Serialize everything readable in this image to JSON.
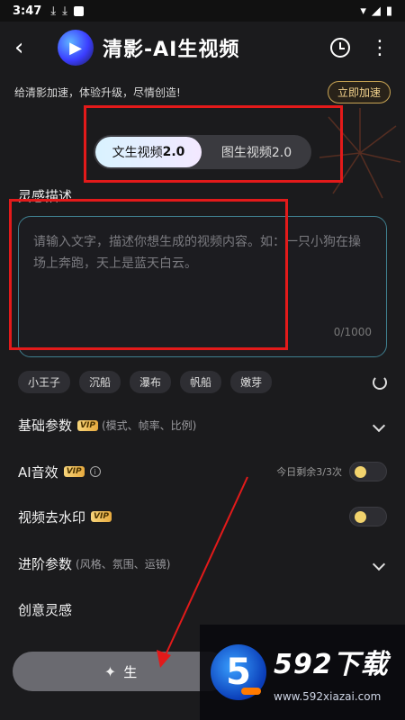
{
  "status": {
    "time": "3:47"
  },
  "header": {
    "back": "‹",
    "logo_letter": "▶",
    "title": "清影-AI生视频"
  },
  "promo": {
    "text": "给清影加速，体验升级，尽情创造!",
    "button": "立即加速"
  },
  "modes": {
    "active_label": "文生视频",
    "active_version": "2.0",
    "inactive_label": "图生视频2.0"
  },
  "prompt": {
    "label": "灵感描述",
    "placeholder": "请输入文字，描述你想生成的视频内容。如：一只小狗在操场上奔跑，天上是蓝天白云。",
    "counter": "0/1000"
  },
  "chips": [
    "小王子",
    "沉船",
    "瀑布",
    "帆船",
    "嫩芽"
  ],
  "settings": {
    "basic": {
      "title": "基础参数",
      "vip": "VIP",
      "sub": "(模式、帧率、比例)"
    },
    "audio": {
      "title": "AI音效",
      "vip": "VIP",
      "quota": "今日剩余3/3次"
    },
    "watermark": {
      "title": "视频去水印",
      "vip": "VIP"
    },
    "advanced": {
      "title": "进阶参数",
      "sub": "(风格、氛围、运镜)"
    }
  },
  "inspire": {
    "title": "创意灵感"
  },
  "generate": {
    "label": "生"
  },
  "site_watermark": {
    "title": "592下载",
    "url": "www.592xiazai.com",
    "logo": "5"
  },
  "colors": {
    "annotation_red": "#e31a1a",
    "vip_gold": "#e6a93e",
    "toggle_knob": "#f2d36d"
  }
}
